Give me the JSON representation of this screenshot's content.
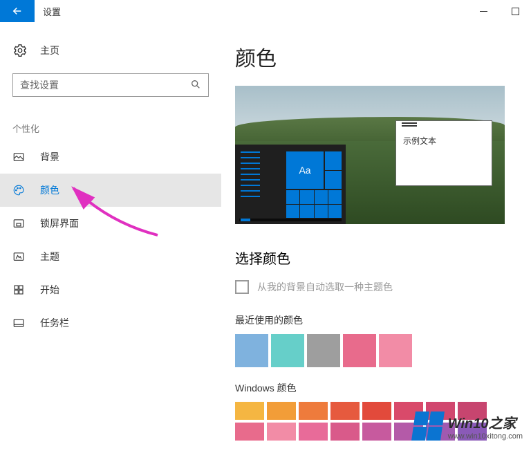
{
  "titlebar": {
    "title": "设置"
  },
  "sidebar": {
    "home": "主页",
    "search_placeholder": "查找设置",
    "section": "个性化",
    "items": [
      {
        "label": "背景"
      },
      {
        "label": "颜色"
      },
      {
        "label": "锁屏界面"
      },
      {
        "label": "主题"
      },
      {
        "label": "开始"
      },
      {
        "label": "任务栏"
      }
    ]
  },
  "content": {
    "page_title": "颜色",
    "sample_text": "示例文本",
    "tile_text": "Aa",
    "choose_color": "选择颜色",
    "auto_pick": "从我的背景自动选取一种主题色",
    "recent_label": "最近使用的颜色",
    "recent_colors": [
      "#7fb2de",
      "#66cfc9",
      "#9e9e9e",
      "#e86b8c",
      "#f28ca6"
    ],
    "windows_label": "Windows 颜色",
    "windows_colors_row1": [
      "#f5b642",
      "#f29d38",
      "#ee7b3c",
      "#e65a3e",
      "#e24a3b",
      "#d94a6a",
      "#d1476f",
      "#c7456f"
    ],
    "windows_colors_row2": [
      "#e86b8c",
      "#f28ca6",
      "#e86b99",
      "#d95a8a",
      "#c75a9e",
      "#b45aa8",
      "#a05ab0",
      "#8a5ab8"
    ]
  },
  "watermark": {
    "title": "Win10之家",
    "url": "www.win10xitong.com"
  }
}
